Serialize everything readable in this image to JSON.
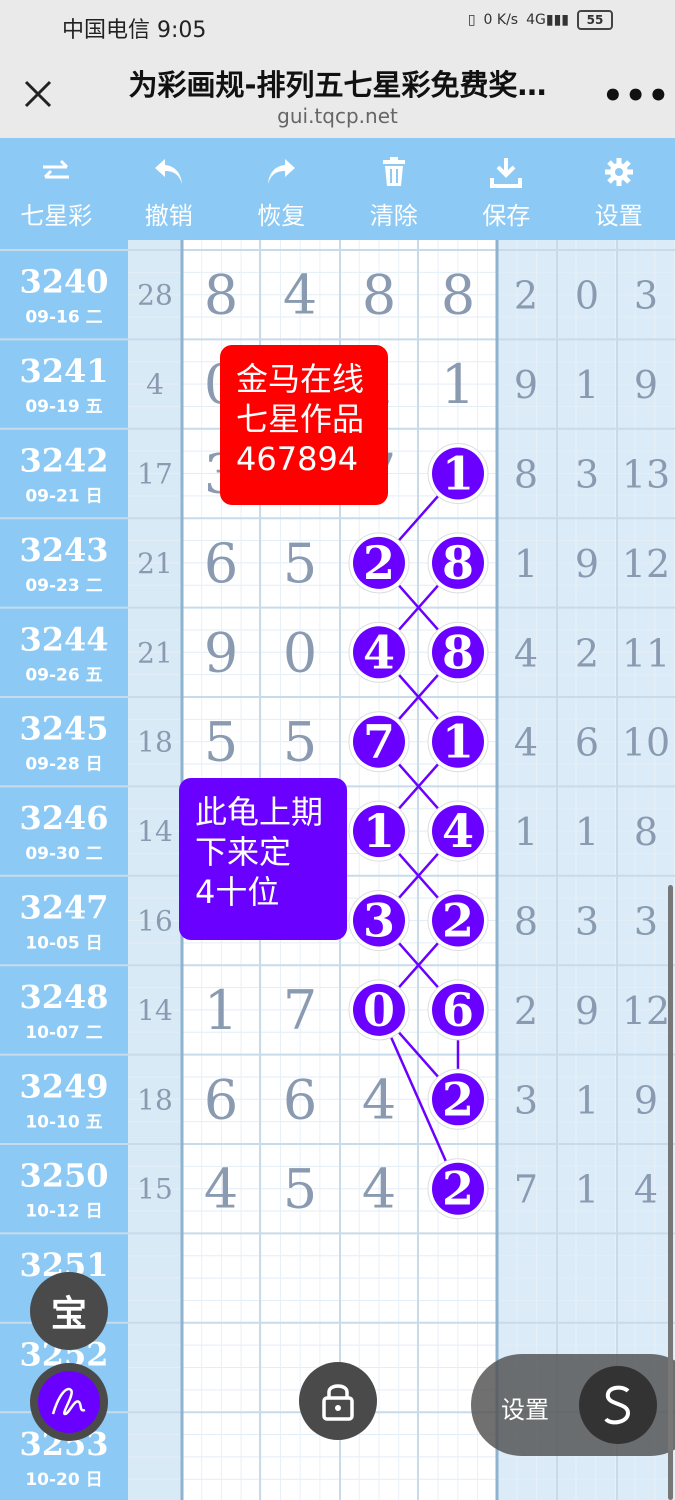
{
  "status": {
    "carrier_time": "中国电信 9:05",
    "net_speed": "0 K/s",
    "signal": "4G",
    "battery": "55"
  },
  "header": {
    "title": "为彩画规-排列五七星彩免费奖…",
    "domain": "gui.tqcp.net"
  },
  "toolbar": [
    {
      "label": "七星彩",
      "icon": "swap-icon"
    },
    {
      "label": "撤销",
      "icon": "undo-icon"
    },
    {
      "label": "恢复",
      "icon": "redo-icon"
    },
    {
      "label": "清除",
      "icon": "trash-icon"
    },
    {
      "label": "保存",
      "icon": "download-icon"
    },
    {
      "label": "设置",
      "icon": "gear-icon"
    }
  ],
  "rows": [
    {
      "issue": "3240",
      "date": "09-16 二",
      "sum": "28",
      "d": [
        "8",
        "4",
        "8",
        "8"
      ],
      "r": [
        "2",
        "0",
        "3"
      ]
    },
    {
      "issue": "3241",
      "date": "09-19 五",
      "sum": "4",
      "d": [
        "0",
        "",
        "1",
        "1"
      ],
      "r": [
        "9",
        "1",
        "9"
      ]
    },
    {
      "issue": "3242",
      "date": "09-21 日",
      "sum": "17",
      "d": [
        "3",
        "",
        "7",
        "1"
      ],
      "r": [
        "8",
        "3",
        "13"
      ]
    },
    {
      "issue": "3243",
      "date": "09-23 二",
      "sum": "21",
      "d": [
        "6",
        "5",
        "2",
        "8"
      ],
      "r": [
        "1",
        "9",
        "12"
      ]
    },
    {
      "issue": "3244",
      "date": "09-26 五",
      "sum": "21",
      "d": [
        "9",
        "0",
        "4",
        "8"
      ],
      "r": [
        "4",
        "2",
        "11"
      ]
    },
    {
      "issue": "3245",
      "date": "09-28 日",
      "sum": "18",
      "d": [
        "5",
        "5",
        "7",
        "1"
      ],
      "r": [
        "4",
        "6",
        "10"
      ]
    },
    {
      "issue": "3246",
      "date": "09-30 二",
      "sum": "14",
      "d": [
        "",
        "",
        "1",
        "4"
      ],
      "r": [
        "1",
        "1",
        "8"
      ]
    },
    {
      "issue": "3247",
      "date": "10-05 日",
      "sum": "16",
      "d": [
        "",
        "",
        "3",
        "2"
      ],
      "r": [
        "8",
        "3",
        "3"
      ]
    },
    {
      "issue": "3248",
      "date": "10-07 二",
      "sum": "14",
      "d": [
        "1",
        "7",
        "0",
        "6"
      ],
      "r": [
        "2",
        "9",
        "12"
      ]
    },
    {
      "issue": "3249",
      "date": "10-10 五",
      "sum": "18",
      "d": [
        "6",
        "6",
        "4",
        "2"
      ],
      "r": [
        "3",
        "1",
        "9"
      ]
    },
    {
      "issue": "3250",
      "date": "10-12 日",
      "sum": "15",
      "d": [
        "4",
        "5",
        "4",
        "2"
      ],
      "r": [
        "7",
        "1",
        "4"
      ]
    },
    {
      "issue": "3251",
      "date": "",
      "sum": "",
      "d": [
        "",
        "",
        "",
        ""
      ],
      "r": [
        "",
        "",
        ""
      ]
    },
    {
      "issue": "3252",
      "date": "",
      "sum": "",
      "d": [
        "",
        "",
        "",
        ""
      ],
      "r": [
        "",
        "",
        ""
      ]
    },
    {
      "issue": "3253",
      "date": "10-20 日",
      "sum": "",
      "d": [
        "",
        "",
        "",
        ""
      ],
      "r": [
        "",
        "",
        ""
      ]
    }
  ],
  "circled": [
    {
      "row": 2,
      "col": 3,
      "value": "1"
    },
    {
      "row": 3,
      "col": 2,
      "value": "2"
    },
    {
      "row": 3,
      "col": 3,
      "value": "8"
    },
    {
      "row": 4,
      "col": 2,
      "value": "4"
    },
    {
      "row": 4,
      "col": 3,
      "value": "8"
    },
    {
      "row": 5,
      "col": 2,
      "value": "7"
    },
    {
      "row": 5,
      "col": 3,
      "value": "1"
    },
    {
      "row": 6,
      "col": 2,
      "value": "1"
    },
    {
      "row": 6,
      "col": 3,
      "value": "4"
    },
    {
      "row": 7,
      "col": 2,
      "value": "3"
    },
    {
      "row": 7,
      "col": 3,
      "value": "2"
    },
    {
      "row": 8,
      "col": 2,
      "value": "0"
    },
    {
      "row": 8,
      "col": 3,
      "value": "6"
    },
    {
      "row": 9,
      "col": 3,
      "value": "2"
    },
    {
      "row": 10,
      "col": 3,
      "value": "2"
    }
  ],
  "notes": {
    "red": [
      "金马在线",
      "七星作品",
      "467894"
    ],
    "purple": [
      "此龟上期",
      "下来定",
      "4十位"
    ]
  },
  "fab": {
    "bao": "宝",
    "settings_label": "设置"
  },
  "colors": {
    "toolbar": "#8ccaf5",
    "note_red": "#ff0000",
    "note_purple": "#6a00ff",
    "circle": "#6a00ff"
  }
}
